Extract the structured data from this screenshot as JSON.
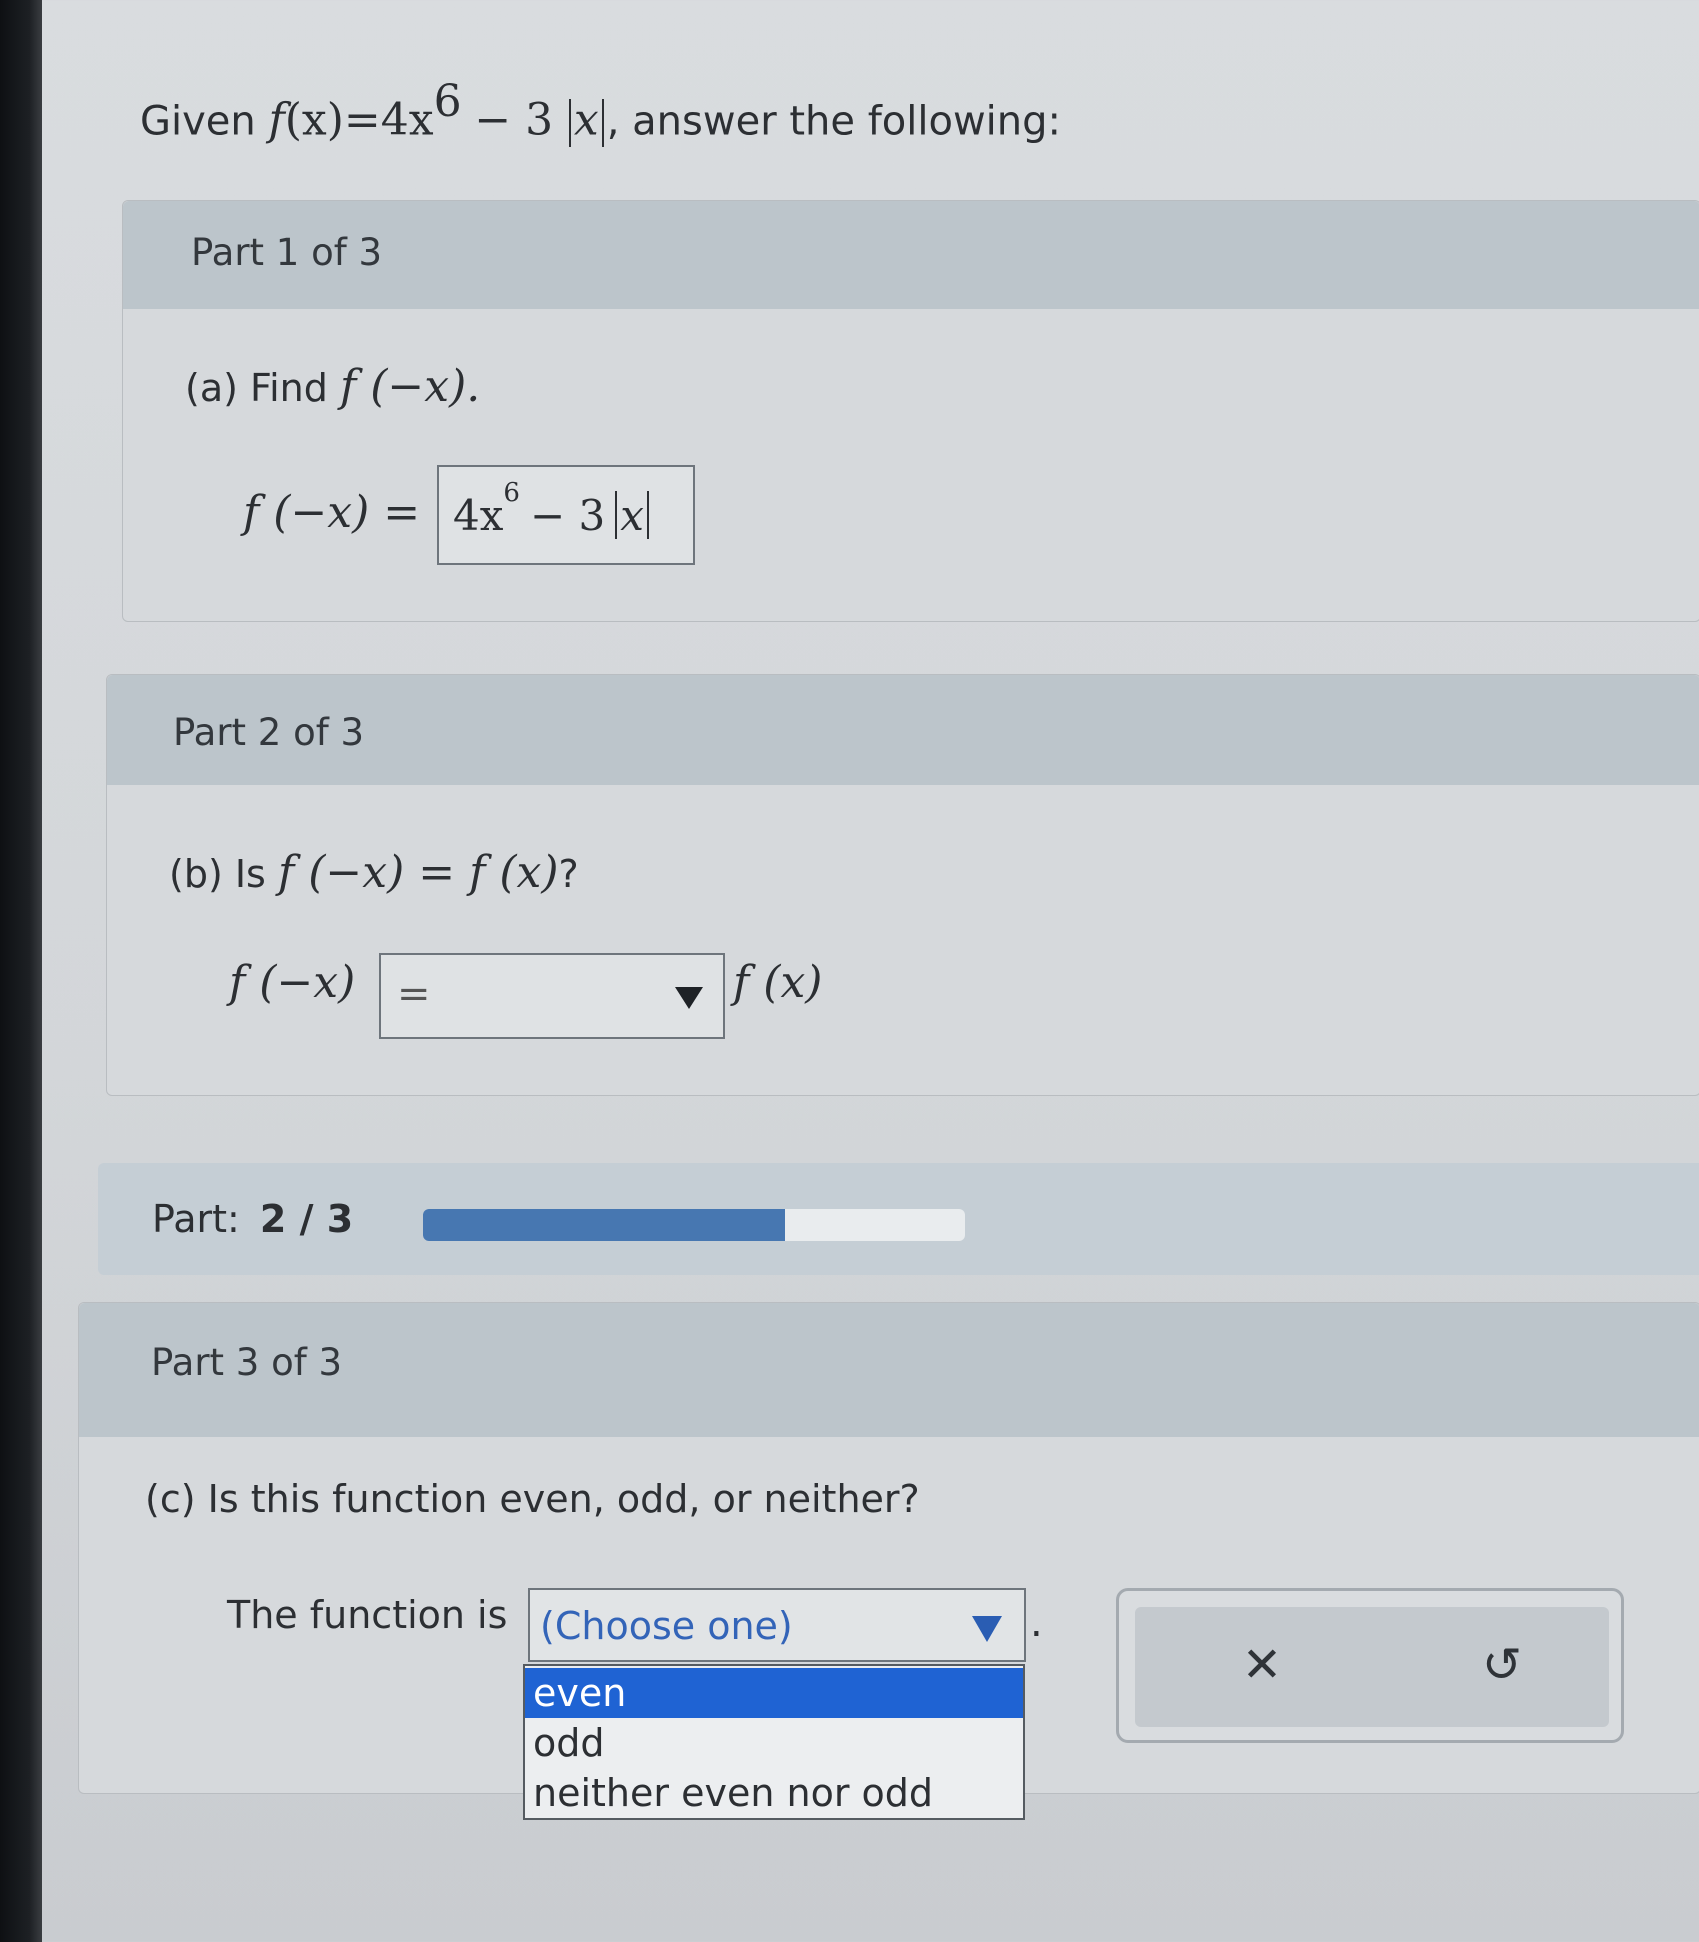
{
  "question": {
    "prefix": "Given",
    "f": "f",
    "paren_x": "(x)",
    "eq": "=",
    "coef": "4x",
    "exp": "6",
    "minus3": "− 3",
    "absx": "x",
    "suffix": ", answer the following:"
  },
  "part1": {
    "title": "Part 1 of 3",
    "prompt_label": "(a) Find",
    "prompt_math": "f (−x).",
    "lhs": "f (−x) =",
    "answer_coef": "4x",
    "answer_exp": "6",
    "answer_minus": "− 3",
    "answer_abs": "x"
  },
  "part2": {
    "title": "Part 2 of 3",
    "prompt_label": "(b) Is",
    "prompt_math": "f (−x) = f (x)",
    "prompt_q": "?",
    "lhs": "f (−x)",
    "select_value": "=",
    "rhs": "f (x)"
  },
  "progress": {
    "label": "Part:",
    "value_text": "2 / 3",
    "fraction": 0.667,
    "fill_color": "#4777b1"
  },
  "part3": {
    "title": "Part 3 of 3",
    "prompt": "(c) Is this function even, odd, or neither?",
    "lead": "The function is",
    "select_placeholder": "(Choose one)",
    "period": ".",
    "options": [
      "even",
      "odd",
      "neither even nor odd"
    ],
    "highlighted_option": "even",
    "highlight_color": "#1f63d3"
  },
  "actions": {
    "clear_icon": "x-icon",
    "undo_icon": "undo-icon",
    "clear_glyph": "✕",
    "undo_glyph": "↺"
  }
}
